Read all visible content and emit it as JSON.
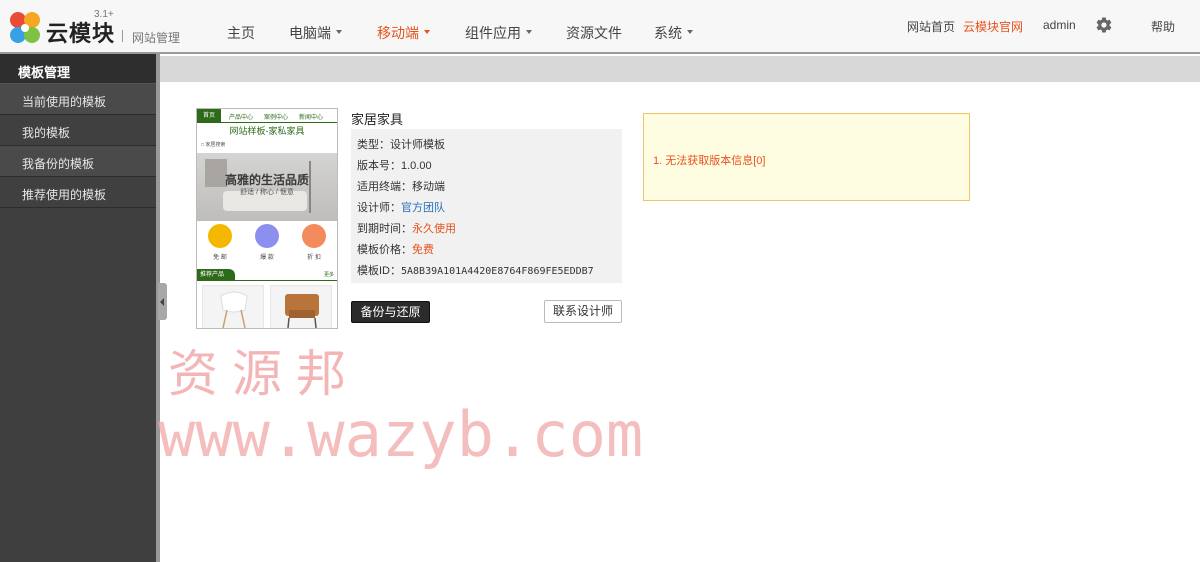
{
  "header": {
    "brand": "云模块",
    "version": "3.1+",
    "subtitle": "网站管理",
    "nav": [
      {
        "label": "主页",
        "dropdown": false,
        "active": false
      },
      {
        "label": "电脑端",
        "dropdown": true,
        "active": false
      },
      {
        "label": "移动端",
        "dropdown": true,
        "active": true
      },
      {
        "label": "组件应用",
        "dropdown": true,
        "active": false
      },
      {
        "label": "资源文件",
        "dropdown": false,
        "active": false
      },
      {
        "label": "系统",
        "dropdown": true,
        "active": false
      }
    ],
    "right": {
      "site_home": "网站首页",
      "official": "云模块官网",
      "user": "admin",
      "settings_icon": "gear-icon",
      "help": "帮助"
    }
  },
  "sidebar": {
    "title": "模板管理",
    "items": [
      {
        "label": "当前使用的模板"
      },
      {
        "label": "我的模板"
      },
      {
        "label": "我备份的模板"
      },
      {
        "label": "推荐使用的模板"
      }
    ]
  },
  "template": {
    "name": "家居家具",
    "thumbnail": {
      "nav": [
        "首页",
        "产品中心",
        "案例中心",
        "新闻中心"
      ],
      "title": "网站样板-家私家具",
      "search": "□ 家居搜索",
      "slogan": "高雅的生活品质",
      "sub": "舒适 / 称心 / 惬意",
      "icons": [
        "免 邮",
        "爆 款",
        "折 扣"
      ],
      "recommend": "推荐产品",
      "more": "更多"
    },
    "info": {
      "type_label": "类型：",
      "type_value": "设计师模板",
      "version_label": "版本号：",
      "version_value": "1.0.00",
      "terminal_label": "适用终端：",
      "terminal_value": "移动端",
      "designer_label": "设计师：",
      "designer_value": "官方团队",
      "expire_label": "到期时间：",
      "expire_value": "永久使用",
      "price_label": "模板价格：",
      "price_value": "免费",
      "id_label": "模板ID：",
      "id_value": "5A8B39A101A4420E8764F869FE5EDDB7"
    },
    "buttons": {
      "backup": "备份与还原",
      "contact": "联系设计师"
    }
  },
  "notice": {
    "text": "1. 无法获取版本信息[0]"
  },
  "watermark": {
    "line1": "资源邦",
    "line2": "www.wazyb.com"
  },
  "colors": {
    "accent": "#e8521e",
    "link_blue": "#2a6ebb",
    "sidebar_bg": "#3f3f3f",
    "notice_bg": "#fffde1",
    "notice_border": "#f1c46a",
    "thumb_green": "#2d6a1a",
    "watermark": "#f2a9a9"
  }
}
